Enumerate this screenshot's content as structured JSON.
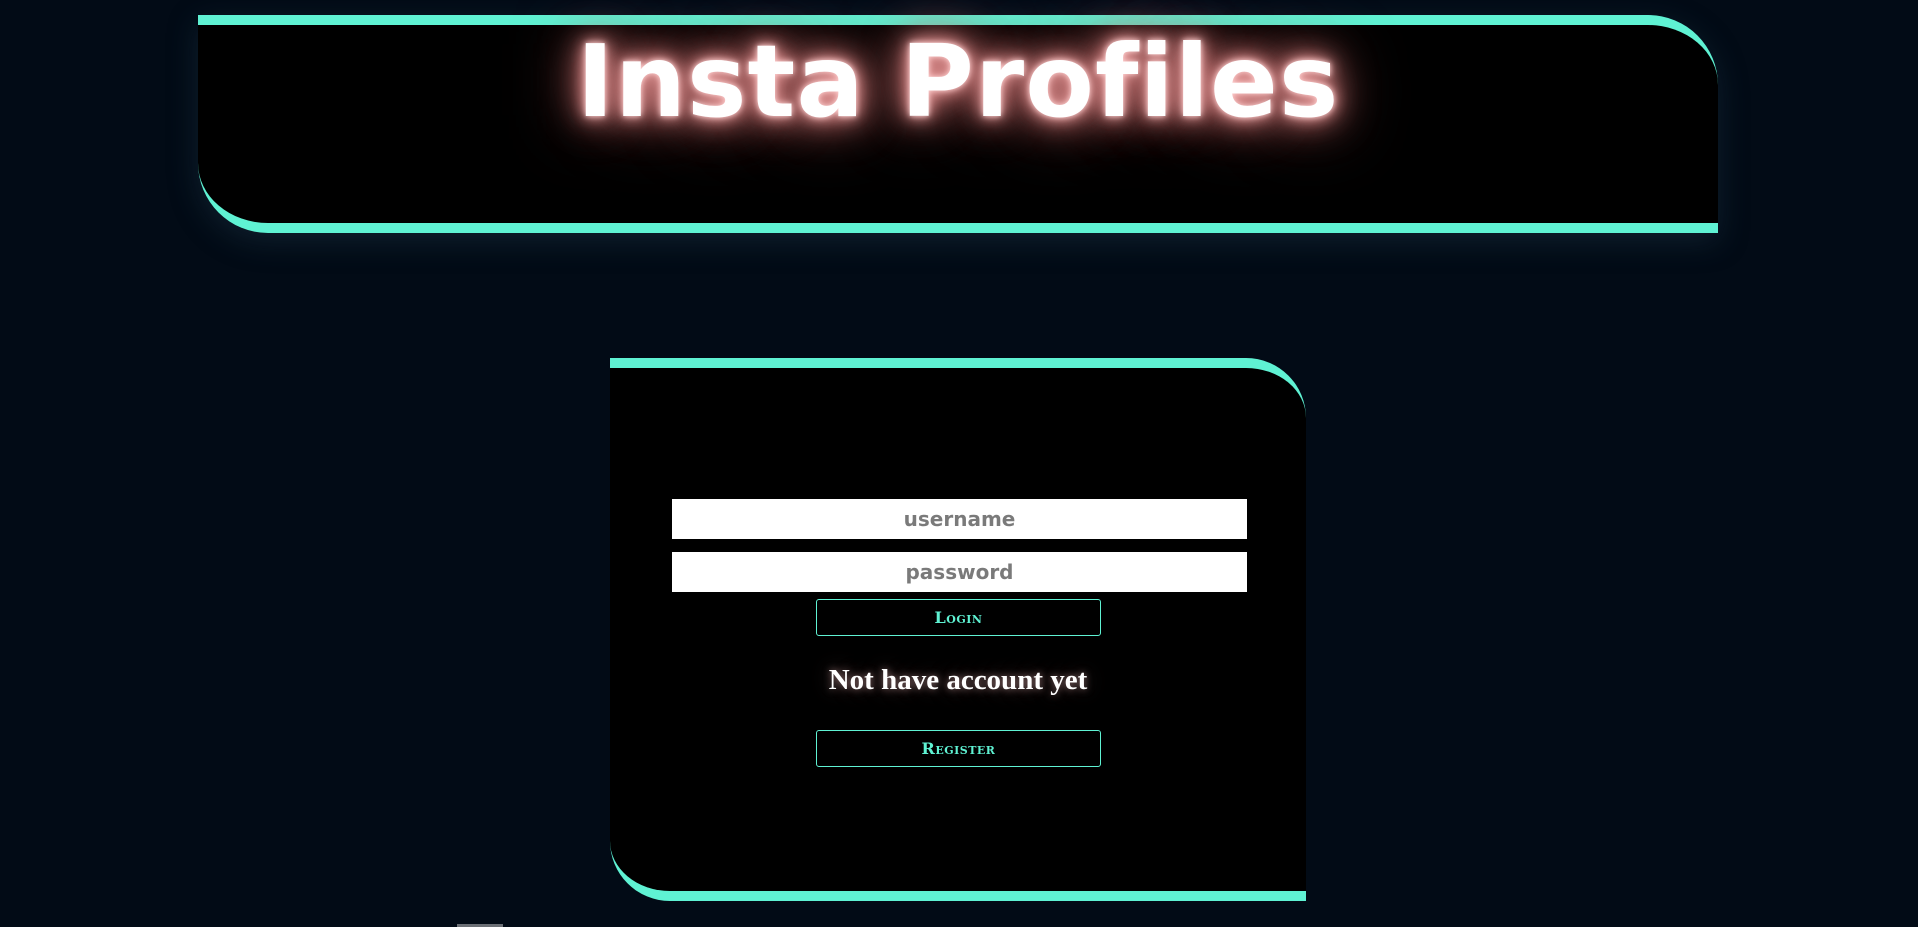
{
  "header": {
    "title": "Insta Profiles"
  },
  "login_form": {
    "username_placeholder": "username",
    "password_placeholder": "password",
    "login_label": "Login",
    "register_prompt": "Not have account yet",
    "register_label": "Register"
  },
  "colors": {
    "background": "#020b16",
    "panel": "#000000",
    "accent": "#5ff2d3",
    "title_glow": "#e08a8a"
  }
}
